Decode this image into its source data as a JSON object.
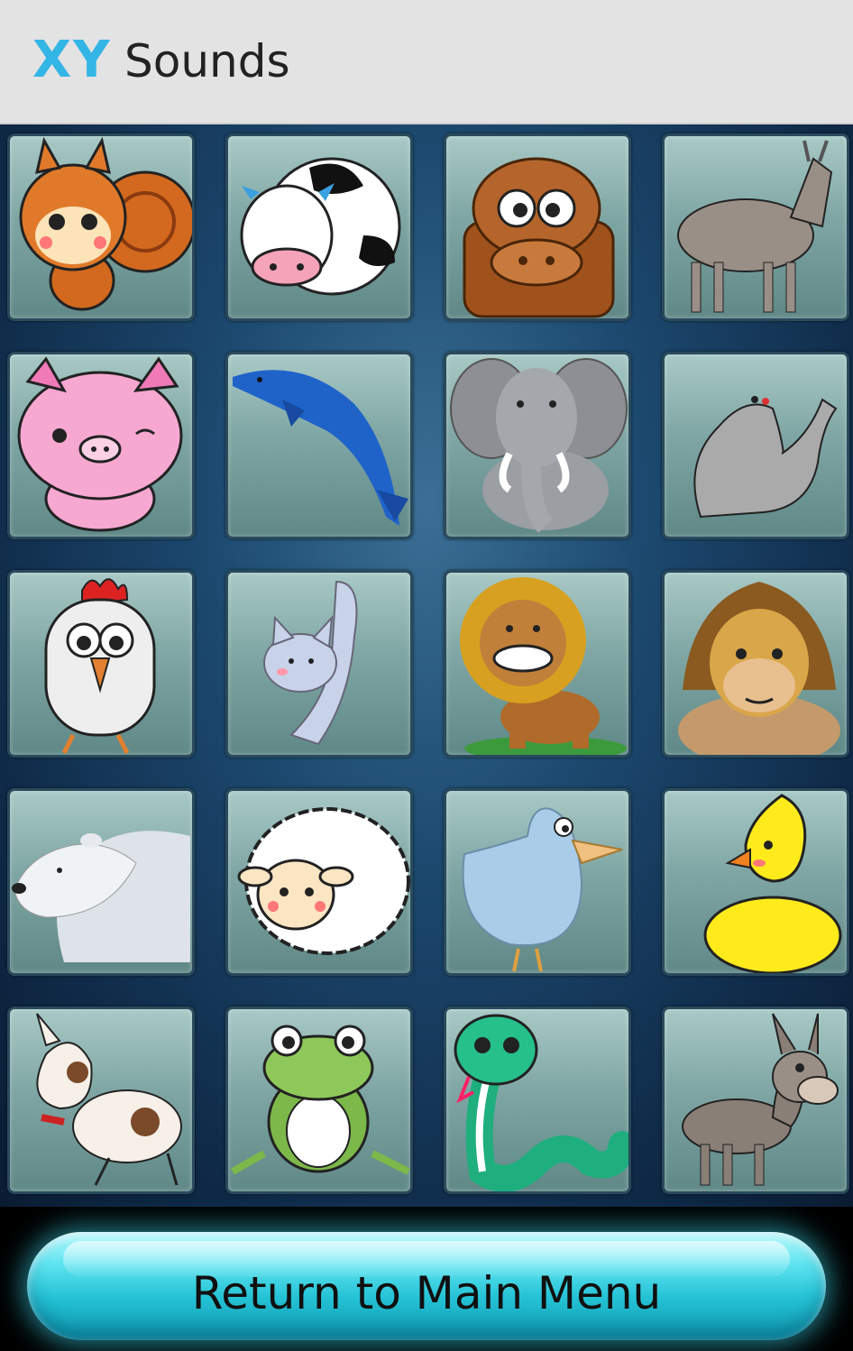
{
  "app": {
    "logo": "XY",
    "title": "Sounds"
  },
  "animals": [
    {
      "name": "squirrel",
      "icon": "squirrel-icon"
    },
    {
      "name": "cow",
      "icon": "cow-icon"
    },
    {
      "name": "hippo",
      "icon": "hippo-icon"
    },
    {
      "name": "goat",
      "icon": "goat-icon"
    },
    {
      "name": "pig",
      "icon": "pig-icon"
    },
    {
      "name": "dolphin",
      "icon": "dolphin-icon"
    },
    {
      "name": "elephant",
      "icon": "elephant-icon"
    },
    {
      "name": "seal",
      "icon": "seal-icon"
    },
    {
      "name": "rooster",
      "icon": "rooster-icon"
    },
    {
      "name": "cat",
      "icon": "cat-icon"
    },
    {
      "name": "lion",
      "icon": "lion-icon"
    },
    {
      "name": "monkey",
      "icon": "monkey-icon"
    },
    {
      "name": "polar-bear",
      "icon": "polar-bear-icon"
    },
    {
      "name": "sheep",
      "icon": "sheep-icon"
    },
    {
      "name": "bird",
      "icon": "bird-icon"
    },
    {
      "name": "duck",
      "icon": "duck-icon"
    },
    {
      "name": "dog",
      "icon": "dog-icon"
    },
    {
      "name": "frog",
      "icon": "frog-icon"
    },
    {
      "name": "snake",
      "icon": "snake-icon"
    },
    {
      "name": "donkey",
      "icon": "donkey-icon"
    }
  ],
  "footer": {
    "return_label": "Return to Main Menu"
  },
  "colors": {
    "accent": "#33b5e5",
    "button": "#25c3d6",
    "tile": "#7fa6a4"
  }
}
